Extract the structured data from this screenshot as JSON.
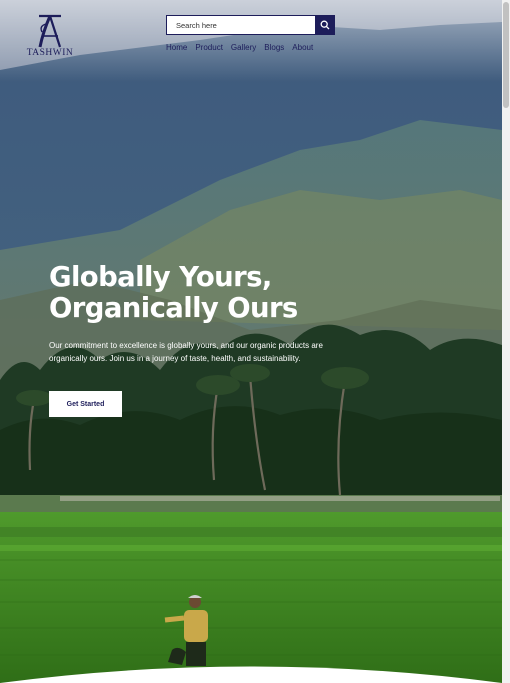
{
  "logo": {
    "text": "TASHWIN",
    "icon": "monogram-logo"
  },
  "search": {
    "placeholder": "Search here",
    "icon": "search-icon"
  },
  "nav": {
    "items": [
      "Home",
      "Product",
      "Gallery",
      "Blogs",
      "About"
    ]
  },
  "hero": {
    "headline_line1": "Globally Yours,",
    "headline_line2": "Organically Ours",
    "subtext": "Our commitment to excellence is globally yours, and our organic products are organically ours. Join us in a journey of taste, health, and sustainability.",
    "cta_label": "Get Started"
  },
  "colors": {
    "brand": "#1d1d5a",
    "text_light": "#ffffff"
  }
}
